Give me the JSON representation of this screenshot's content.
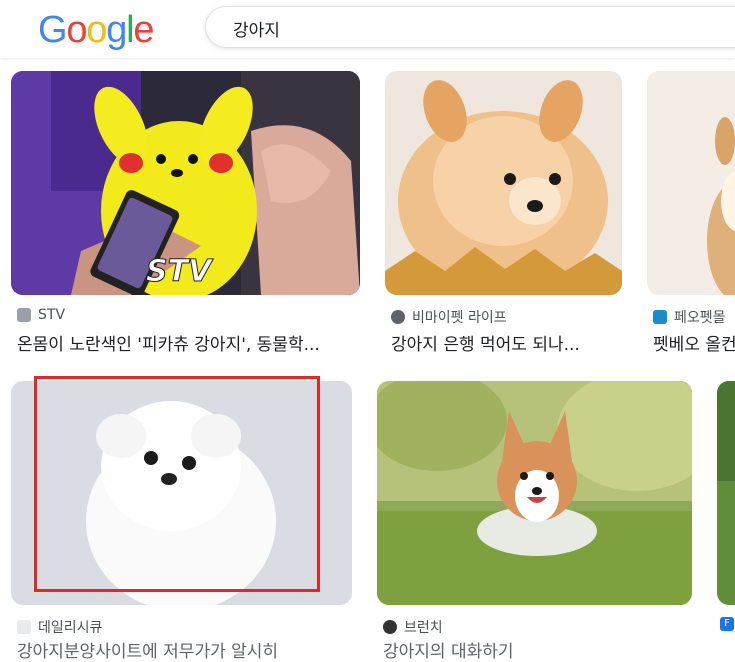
{
  "header": {
    "logo_letters": [
      {
        "ch": "G",
        "color": "#4285F4"
      },
      {
        "ch": "o",
        "color": "#EA4335"
      },
      {
        "ch": "o",
        "color": "#FBBC05"
      },
      {
        "ch": "g",
        "color": "#4285F4"
      },
      {
        "ch": "l",
        "color": "#34A853"
      },
      {
        "ch": "e",
        "color": "#EA4335"
      }
    ],
    "search_query": "강아지"
  },
  "results": [
    {
      "source": "STV",
      "title": "온몸이 노란색인 '피카츄 강아지', 동물학..."
    },
    {
      "source": "비마이펫 라이프",
      "title": "강아지 은행 먹어도 되나..."
    },
    {
      "source": "페오펫몰",
      "title": "펫베오 올컨"
    },
    {
      "source": "데일리시큐",
      "title": "강아지분양사이트에 저무가가 알시히"
    },
    {
      "source": "브런치",
      "title": "강아지의 대화하기"
    },
    {
      "source": "F",
      "title": ""
    }
  ],
  "colors": {
    "selection_box": "#e02a2a",
    "source_text": "#4d5156",
    "title_text": "#202124"
  }
}
